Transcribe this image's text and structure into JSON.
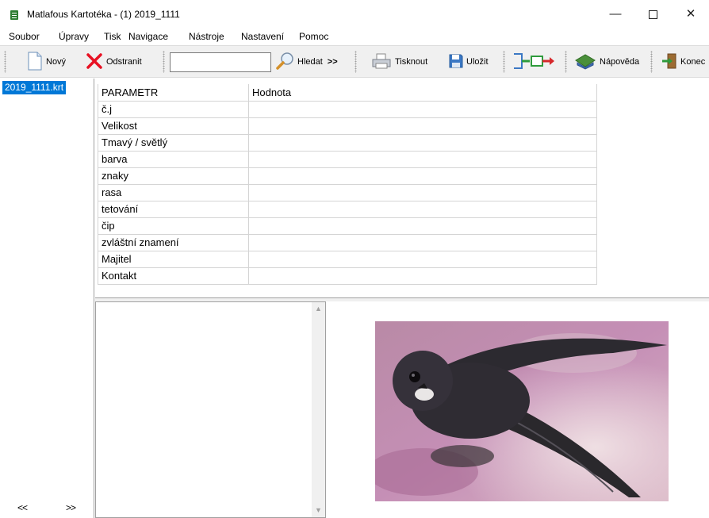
{
  "window": {
    "title": "Matlafous Kartotéka - (1) 2019_1111",
    "min_glyph": "—",
    "close_glyph": "✕"
  },
  "menu": [
    "Soubor",
    "Úpravy",
    "Tisk",
    "Navigace",
    "Nástroje",
    "Nastavení",
    "Pomoc"
  ],
  "toolbar": {
    "new_label": "Nový",
    "delete_label": "Odstranit",
    "search_value": "",
    "find_label": "Hledat",
    "find_more": ">>",
    "print_label": "Tisknout",
    "save_label": "Uložit",
    "help_label": "Nápověda",
    "exit_label": "Konec"
  },
  "files": {
    "items": [
      "2019_1111.krt"
    ],
    "prev_label": "<<",
    "next_label": ">>"
  },
  "grid": {
    "headers": [
      "PARAMETR",
      "Hodnota"
    ],
    "rows": [
      [
        "č.j",
        ""
      ],
      [
        "Velikost",
        ""
      ],
      [
        "Tmavý / světlý",
        ""
      ],
      [
        "barva",
        ""
      ],
      [
        "znaky",
        ""
      ],
      [
        "rasa",
        ""
      ],
      [
        "tetování",
        ""
      ],
      [
        "čip",
        ""
      ],
      [
        "zvláštní znamení",
        ""
      ],
      [
        "Majitel",
        ""
      ],
      [
        "Kontakt",
        ""
      ]
    ]
  },
  "notes": {
    "text": ""
  },
  "colors": {
    "selection": "#0078d7",
    "toolbar_bg": "#f0f0f0",
    "delete_icon": "#e81123",
    "app_icon": "#2e7d32"
  },
  "icons": {
    "app": "card-file-icon",
    "new": "new-document-icon",
    "delete": "red-x-icon",
    "find": "magnifier-icon",
    "print": "printer-icon",
    "save": "floppy-disk-icon",
    "navigate": "flow-arrows-icon",
    "help": "help-book-icon",
    "exit": "exit-door-icon"
  }
}
